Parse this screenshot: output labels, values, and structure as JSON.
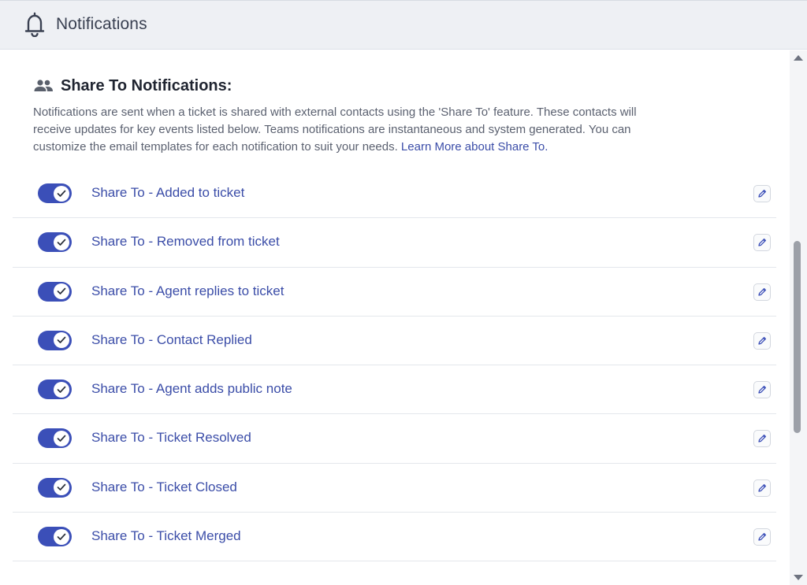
{
  "header": {
    "title": "Notifications",
    "icon": "bell-icon"
  },
  "section": {
    "icon": "people-icon",
    "title": "Share To Notifications:",
    "description": "Notifications are sent when a ticket is shared with external contacts using the 'Share To' feature. These contacts will receive updates for key events listed below. Teams notifications are instantaneous and system generated. You can customize the email templates for each notification to suit your needs.",
    "link_text": "Learn More about Share To."
  },
  "notifications": [
    {
      "label": "Share To - Added to ticket",
      "enabled": true
    },
    {
      "label": "Share To - Removed from ticket",
      "enabled": true
    },
    {
      "label": "Share To - Agent replies to ticket",
      "enabled": true
    },
    {
      "label": "Share To - Contact Replied",
      "enabled": true
    },
    {
      "label": "Share To - Agent adds public note",
      "enabled": true
    },
    {
      "label": "Share To - Ticket Resolved",
      "enabled": true
    },
    {
      "label": "Share To - Ticket Closed",
      "enabled": true
    },
    {
      "label": "Share To - Ticket Merged",
      "enabled": true
    }
  ],
  "colors": {
    "accent": "#3b4fb8",
    "link": "#3b4da8",
    "header_bg": "#eef0f4"
  }
}
